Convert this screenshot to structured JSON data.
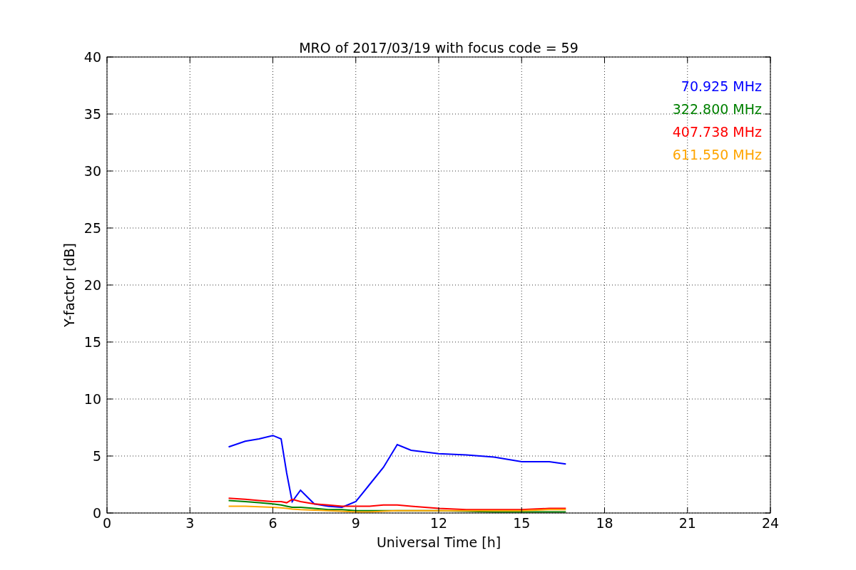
{
  "chart_data": {
    "type": "line",
    "title": "MRO of 2017/03/19 with focus code = 59",
    "xlabel": "Universal Time [h]",
    "ylabel": "Y-factor [dB]",
    "x": [
      4.4,
      5,
      5.5,
      6,
      6.3,
      6.5,
      6.7,
      7,
      7.5,
      8,
      8.5,
      9,
      9.5,
      10,
      10.5,
      11,
      12,
      13,
      14,
      15,
      16,
      16.6
    ],
    "series": [
      {
        "name": "70.925 MHz",
        "color": "#0000ff",
        "values": [
          5.8,
          6.3,
          6.5,
          6.8,
          6.5,
          3.5,
          1.0,
          2.0,
          0.8,
          0.6,
          0.5,
          1.0,
          2.5,
          4.0,
          6.0,
          5.5,
          5.2,
          5.1,
          4.9,
          4.5,
          4.5,
          4.3
        ]
      },
      {
        "name": "322.800 MHz",
        "color": "#008000",
        "values": [
          1.1,
          1.0,
          0.9,
          0.8,
          0.7,
          0.6,
          0.5,
          0.5,
          0.4,
          0.3,
          0.3,
          0.2,
          0.2,
          0.2,
          0.2,
          0.2,
          0.2,
          0.15,
          0.1,
          0.1,
          0.1,
          0.1
        ]
      },
      {
        "name": "407.738 MHz",
        "color": "#ff0000",
        "values": [
          1.3,
          1.2,
          1.1,
          1.0,
          1.0,
          0.9,
          1.2,
          1.0,
          0.8,
          0.7,
          0.6,
          0.6,
          0.6,
          0.7,
          0.7,
          0.6,
          0.4,
          0.3,
          0.3,
          0.3,
          0.4,
          0.4
        ]
      },
      {
        "name": "611.550 MHz",
        "color": "#ffa500",
        "values": [
          0.6,
          0.6,
          0.55,
          0.5,
          0.45,
          0.4,
          0.35,
          0.3,
          0.25,
          0.2,
          0.15,
          0.1,
          0.1,
          0.15,
          0.2,
          0.2,
          0.2,
          0.2,
          0.2,
          0.2,
          0.3,
          0.3
        ]
      }
    ],
    "grid": true,
    "xlim": [
      0,
      24
    ],
    "ylim": [
      0,
      40
    ],
    "xticks": [
      0,
      3,
      6,
      9,
      12,
      15,
      18,
      21,
      24
    ],
    "yticks": [
      0,
      5,
      10,
      15,
      20,
      25,
      30,
      35,
      40
    ]
  }
}
